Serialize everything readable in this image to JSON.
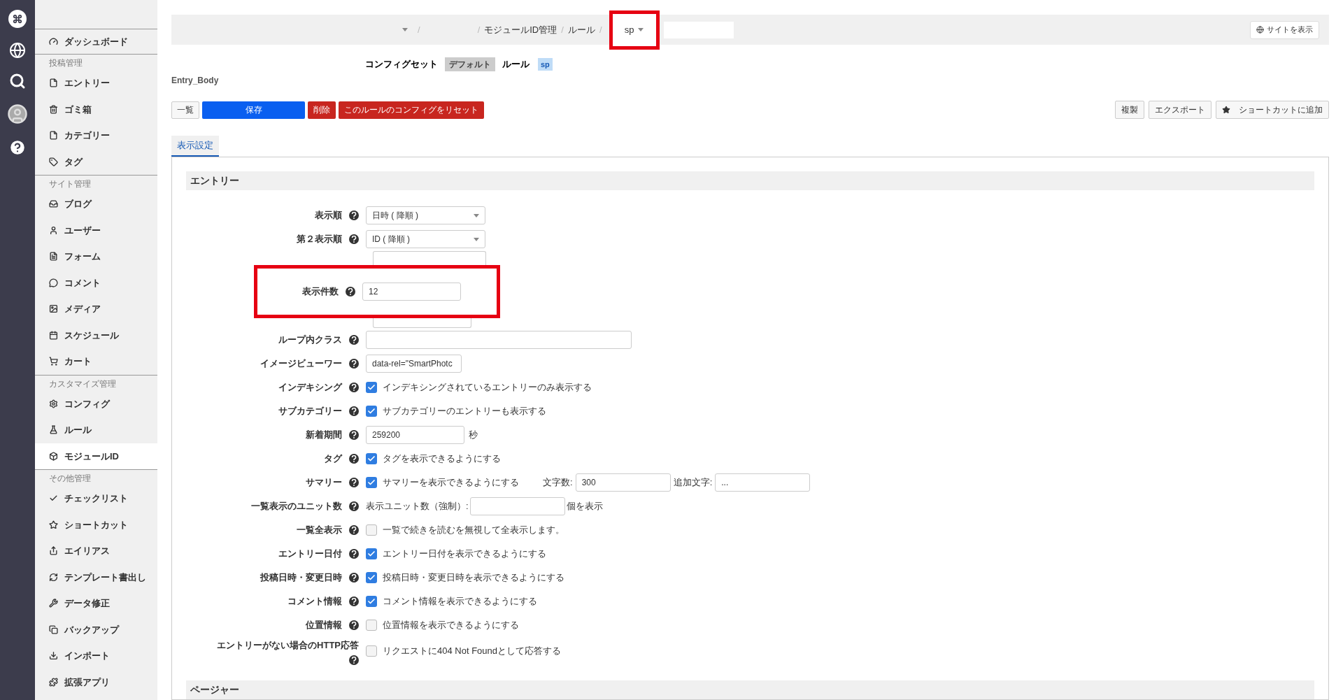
{
  "sidebar": {
    "top": {
      "label": "ダッシュボード",
      "selected": false
    },
    "sections": [
      {
        "heading": "投稿管理",
        "items": [
          {
            "label": "エントリー",
            "selected": false
          },
          {
            "label": "ゴミ箱",
            "selected": false
          },
          {
            "label": "カテゴリー",
            "selected": false
          },
          {
            "label": "タグ",
            "selected": false
          }
        ]
      },
      {
        "heading": "サイト管理",
        "items": [
          {
            "label": "ブログ",
            "selected": false
          },
          {
            "label": "ユーザー",
            "selected": false
          },
          {
            "label": "フォーム",
            "selected": false
          },
          {
            "label": "コメント",
            "selected": false
          },
          {
            "label": "メディア",
            "selected": false
          },
          {
            "label": "スケジュール",
            "selected": false
          },
          {
            "label": "カート",
            "selected": false
          }
        ]
      },
      {
        "heading": "カスタマイズ管理",
        "items": [
          {
            "label": "コンフィグ",
            "selected": false
          },
          {
            "label": "ルール",
            "selected": false
          },
          {
            "label": "モジュールID",
            "selected": true
          }
        ]
      },
      {
        "heading": "その他管理",
        "items": [
          {
            "label": "チェックリスト",
            "selected": false
          },
          {
            "label": "ショートカット",
            "selected": false
          },
          {
            "label": "エイリアス",
            "selected": false
          },
          {
            "label": "テンプレート書出し",
            "selected": false
          },
          {
            "label": "データ修正",
            "selected": false
          },
          {
            "label": "バックアップ",
            "selected": false
          },
          {
            "label": "インポート",
            "selected": false
          },
          {
            "label": "拡張アプリ",
            "selected": false
          }
        ]
      }
    ]
  },
  "breadcrumb": {
    "parts": [
      {
        "kind": "caret"
      },
      {
        "kind": "sep",
        "text": "/"
      },
      {
        "kind": "blank"
      },
      {
        "kind": "sep",
        "text": "/"
      },
      {
        "kind": "link",
        "text": "モジュールID管理"
      },
      {
        "kind": "sep",
        "text": "/"
      },
      {
        "kind": "link",
        "text": "ルール"
      },
      {
        "kind": "sep",
        "text": "/"
      }
    ],
    "current": "sp",
    "highlighted": true,
    "site_button": "サイトを表示"
  },
  "config": {
    "set_label": "コンフィグセット",
    "set_value": "デフォルト",
    "rule_label": "ルール",
    "rule_value": "sp"
  },
  "module_name": "Entry_Body",
  "actions_left": [
    {
      "label": "一覧",
      "kind": "plain"
    },
    {
      "label": "保存",
      "kind": "primary"
    },
    {
      "label": "削除",
      "kind": "danger"
    },
    {
      "label": "このルールのコンフィグをリセット",
      "kind": "danger"
    }
  ],
  "actions_right": [
    {
      "label": "複製",
      "kind": "plain"
    },
    {
      "label": "エクスポート",
      "kind": "plain"
    },
    {
      "label": "ショートカットに追加",
      "kind": "shortcut"
    }
  ],
  "tabs": [
    {
      "label": "表示設定",
      "selected": true
    }
  ],
  "section": {
    "title": "エントリー",
    "next_title": "ページャー"
  },
  "rows": [
    {
      "kind": "select",
      "label": "表示順",
      "value": "日時 ( 降順 )"
    },
    {
      "kind": "select",
      "label": "第２表示順",
      "value": "ID ( 降順 )"
    },
    {
      "kind": "highlight",
      "label": "表示件数",
      "value": "12"
    },
    {
      "kind": "text_wide",
      "label": "ループ内クラス",
      "value": ""
    },
    {
      "kind": "text",
      "label": "イメージビューワー",
      "value": "data-rel=\"SmartPhotc"
    },
    {
      "kind": "checkbox",
      "label": "インデキシング",
      "text": "インデキシングされているエントリーのみ表示する",
      "checked": true
    },
    {
      "kind": "checkbox",
      "label": "サブカテゴリー",
      "text": "サブカテゴリーのエントリーも表示する",
      "checked": true
    },
    {
      "kind": "unit",
      "label": "新着期間",
      "value": "259200",
      "unit": "秒"
    },
    {
      "kind": "checkbox",
      "label": "タグ",
      "text": "タグを表示できるようにする",
      "checked": true
    },
    {
      "kind": "summary",
      "label": "サマリー",
      "text": "サマリーを表示できるようにする",
      "checked": true,
      "count_label": "文字数:",
      "count_value": "300",
      "extra_label": "追加文字:",
      "extra_value": "..."
    },
    {
      "kind": "units",
      "label": "一覧表示のユニット数",
      "prefix": "表示ユニット数（強制）:",
      "value": "",
      "suffix": "個を表示"
    },
    {
      "kind": "checkbox",
      "label": "一覧全表示",
      "text": "一覧で続きを読むを無視して全表示します。",
      "checked": false
    },
    {
      "kind": "checkbox",
      "label": "エントリー日付",
      "text": "エントリー日付を表示できるようにする",
      "checked": true
    },
    {
      "kind": "checkbox",
      "label": "投稿日時・変更日時",
      "text": "投稿日時・変更日時を表示できるようにする",
      "checked": true
    },
    {
      "kind": "checkbox",
      "label": "コメント情報",
      "text": "コメント情報を表示できるようにする",
      "checked": true
    },
    {
      "kind": "checkbox",
      "label": "位置情報",
      "text": "位置情報を表示できるようにする",
      "checked": false
    },
    {
      "kind": "checkbox2",
      "label": "エントリーがない場合のHTTP応答",
      "text": "リクエストに404 Not Foundとして応答する",
      "checked": false
    }
  ]
}
